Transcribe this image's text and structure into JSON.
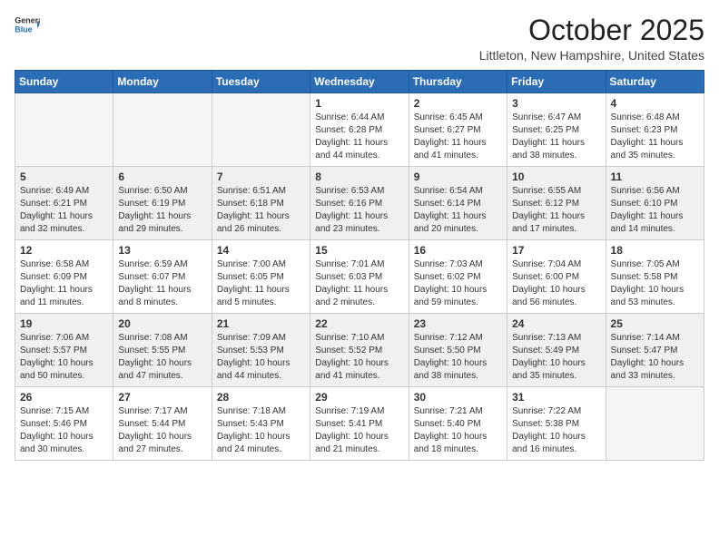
{
  "header": {
    "logo_general": "General",
    "logo_blue": "Blue",
    "month_title": "October 2025",
    "location": "Littleton, New Hampshire, United States"
  },
  "days_of_week": [
    "Sunday",
    "Monday",
    "Tuesday",
    "Wednesday",
    "Thursday",
    "Friday",
    "Saturday"
  ],
  "weeks": [
    [
      {
        "day": "",
        "info": ""
      },
      {
        "day": "",
        "info": ""
      },
      {
        "day": "",
        "info": ""
      },
      {
        "day": "1",
        "info": "Sunrise: 6:44 AM\nSunset: 6:28 PM\nDaylight: 11 hours\nand 44 minutes."
      },
      {
        "day": "2",
        "info": "Sunrise: 6:45 AM\nSunset: 6:27 PM\nDaylight: 11 hours\nand 41 minutes."
      },
      {
        "day": "3",
        "info": "Sunrise: 6:47 AM\nSunset: 6:25 PM\nDaylight: 11 hours\nand 38 minutes."
      },
      {
        "day": "4",
        "info": "Sunrise: 6:48 AM\nSunset: 6:23 PM\nDaylight: 11 hours\nand 35 minutes."
      }
    ],
    [
      {
        "day": "5",
        "info": "Sunrise: 6:49 AM\nSunset: 6:21 PM\nDaylight: 11 hours\nand 32 minutes."
      },
      {
        "day": "6",
        "info": "Sunrise: 6:50 AM\nSunset: 6:19 PM\nDaylight: 11 hours\nand 29 minutes."
      },
      {
        "day": "7",
        "info": "Sunrise: 6:51 AM\nSunset: 6:18 PM\nDaylight: 11 hours\nand 26 minutes."
      },
      {
        "day": "8",
        "info": "Sunrise: 6:53 AM\nSunset: 6:16 PM\nDaylight: 11 hours\nand 23 minutes."
      },
      {
        "day": "9",
        "info": "Sunrise: 6:54 AM\nSunset: 6:14 PM\nDaylight: 11 hours\nand 20 minutes."
      },
      {
        "day": "10",
        "info": "Sunrise: 6:55 AM\nSunset: 6:12 PM\nDaylight: 11 hours\nand 17 minutes."
      },
      {
        "day": "11",
        "info": "Sunrise: 6:56 AM\nSunset: 6:10 PM\nDaylight: 11 hours\nand 14 minutes."
      }
    ],
    [
      {
        "day": "12",
        "info": "Sunrise: 6:58 AM\nSunset: 6:09 PM\nDaylight: 11 hours\nand 11 minutes."
      },
      {
        "day": "13",
        "info": "Sunrise: 6:59 AM\nSunset: 6:07 PM\nDaylight: 11 hours\nand 8 minutes."
      },
      {
        "day": "14",
        "info": "Sunrise: 7:00 AM\nSunset: 6:05 PM\nDaylight: 11 hours\nand 5 minutes."
      },
      {
        "day": "15",
        "info": "Sunrise: 7:01 AM\nSunset: 6:03 PM\nDaylight: 11 hours\nand 2 minutes."
      },
      {
        "day": "16",
        "info": "Sunrise: 7:03 AM\nSunset: 6:02 PM\nDaylight: 10 hours\nand 59 minutes."
      },
      {
        "day": "17",
        "info": "Sunrise: 7:04 AM\nSunset: 6:00 PM\nDaylight: 10 hours\nand 56 minutes."
      },
      {
        "day": "18",
        "info": "Sunrise: 7:05 AM\nSunset: 5:58 PM\nDaylight: 10 hours\nand 53 minutes."
      }
    ],
    [
      {
        "day": "19",
        "info": "Sunrise: 7:06 AM\nSunset: 5:57 PM\nDaylight: 10 hours\nand 50 minutes."
      },
      {
        "day": "20",
        "info": "Sunrise: 7:08 AM\nSunset: 5:55 PM\nDaylight: 10 hours\nand 47 minutes."
      },
      {
        "day": "21",
        "info": "Sunrise: 7:09 AM\nSunset: 5:53 PM\nDaylight: 10 hours\nand 44 minutes."
      },
      {
        "day": "22",
        "info": "Sunrise: 7:10 AM\nSunset: 5:52 PM\nDaylight: 10 hours\nand 41 minutes."
      },
      {
        "day": "23",
        "info": "Sunrise: 7:12 AM\nSunset: 5:50 PM\nDaylight: 10 hours\nand 38 minutes."
      },
      {
        "day": "24",
        "info": "Sunrise: 7:13 AM\nSunset: 5:49 PM\nDaylight: 10 hours\nand 35 minutes."
      },
      {
        "day": "25",
        "info": "Sunrise: 7:14 AM\nSunset: 5:47 PM\nDaylight: 10 hours\nand 33 minutes."
      }
    ],
    [
      {
        "day": "26",
        "info": "Sunrise: 7:15 AM\nSunset: 5:46 PM\nDaylight: 10 hours\nand 30 minutes."
      },
      {
        "day": "27",
        "info": "Sunrise: 7:17 AM\nSunset: 5:44 PM\nDaylight: 10 hours\nand 27 minutes."
      },
      {
        "day": "28",
        "info": "Sunrise: 7:18 AM\nSunset: 5:43 PM\nDaylight: 10 hours\nand 24 minutes."
      },
      {
        "day": "29",
        "info": "Sunrise: 7:19 AM\nSunset: 5:41 PM\nDaylight: 10 hours\nand 21 minutes."
      },
      {
        "day": "30",
        "info": "Sunrise: 7:21 AM\nSunset: 5:40 PM\nDaylight: 10 hours\nand 18 minutes."
      },
      {
        "day": "31",
        "info": "Sunrise: 7:22 AM\nSunset: 5:38 PM\nDaylight: 10 hours\nand 16 minutes."
      },
      {
        "day": "",
        "info": ""
      }
    ]
  ]
}
